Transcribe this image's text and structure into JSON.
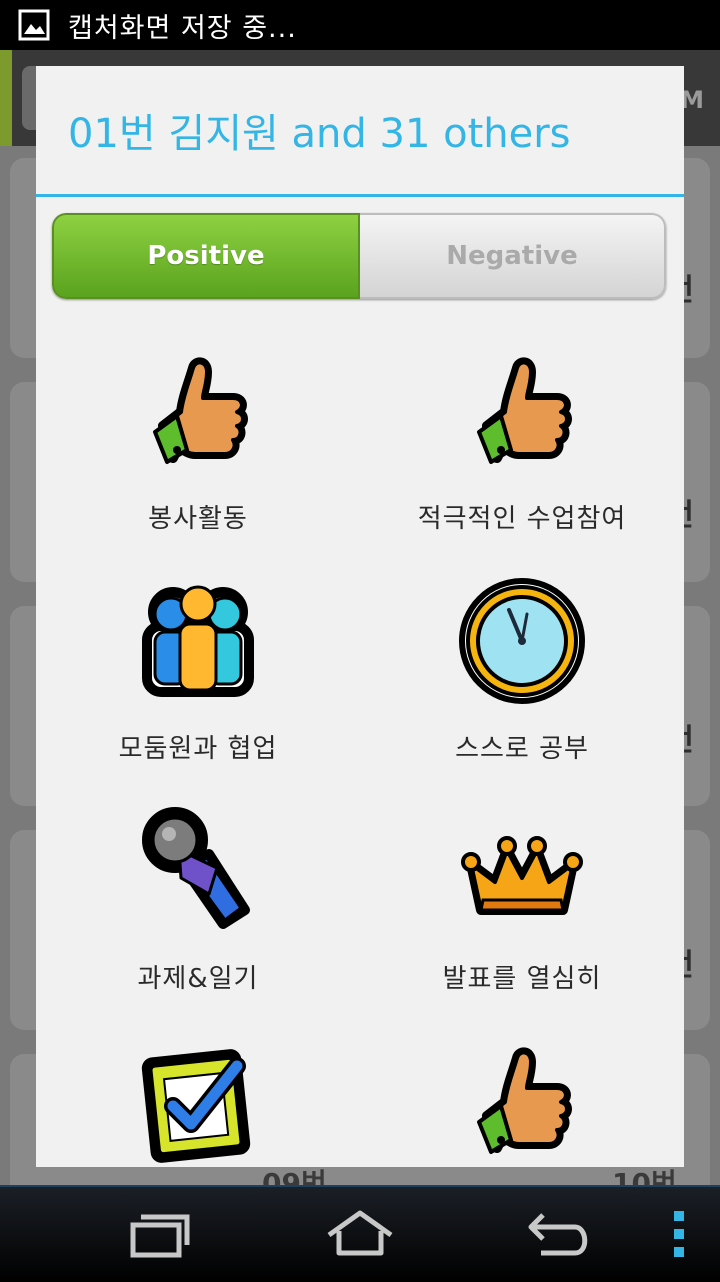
{
  "status_bar": {
    "text": "캡처화면 저장 중...",
    "icon": "picture-icon"
  },
  "background": {
    "header_suffix": "M",
    "edge_texts": [
      "번",
      "",
      "번",
      "",
      "번",
      "",
      "번"
    ],
    "bottom_numbers": [
      "09번",
      "10번"
    ]
  },
  "dialog": {
    "title": "01번 김지원 and 31 others",
    "accent_color": "#33b5e5",
    "tabs": {
      "positive": "Positive",
      "negative": "Negative"
    },
    "behaviors": [
      {
        "label": "봉사활동",
        "icon": "thumbs-up-icon"
      },
      {
        "label": "적극적인 수업참여",
        "icon": "thumbs-up-icon"
      },
      {
        "label": "모둠원과 협업",
        "icon": "team-icon"
      },
      {
        "label": "스스로 공부",
        "icon": "clock-icon"
      },
      {
        "label": "과제&일기",
        "icon": "microphone-icon"
      },
      {
        "label": "발표를 열심히",
        "icon": "crown-icon"
      },
      {
        "label": "",
        "icon": "checkbox-icon"
      },
      {
        "label": "",
        "icon": "thumbs-up-icon"
      }
    ]
  },
  "nav_bar": {
    "buttons": [
      "recent-apps-icon",
      "home-icon",
      "back-icon",
      "menu-icon"
    ]
  }
}
